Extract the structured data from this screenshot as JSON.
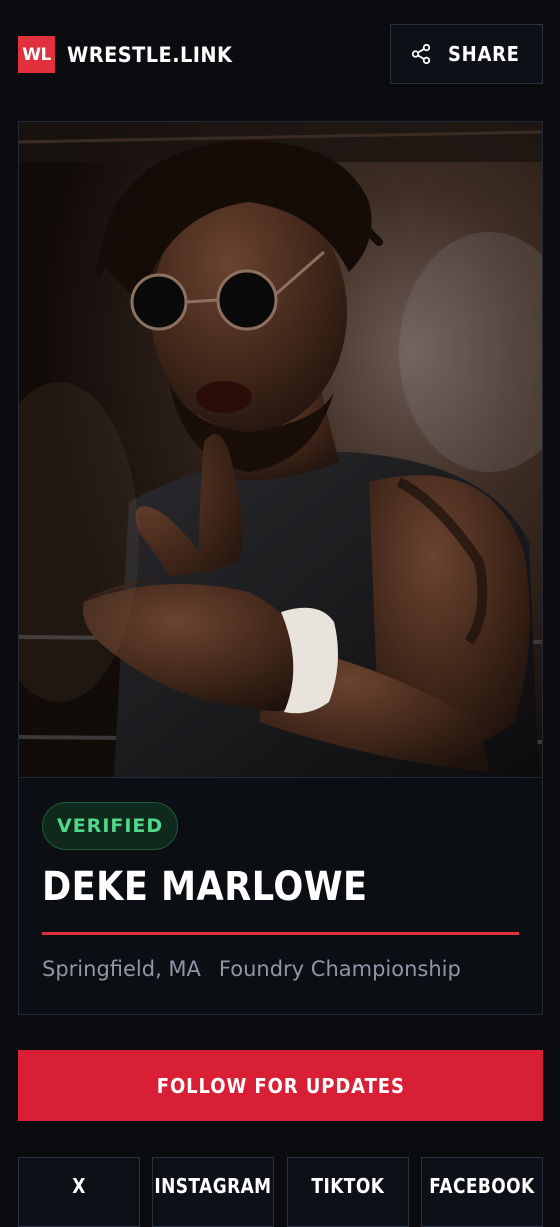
{
  "header": {
    "logo_text": "WL",
    "brand_name": "WRESTLE.LINK",
    "share_label": "SHARE"
  },
  "profile": {
    "badge": "VERIFIED",
    "name": "DEKE MARLOWE",
    "location": "Springfield, MA",
    "promotion": "Foundry Championship"
  },
  "actions": {
    "follow_label": "FOLLOW FOR UPDATES"
  },
  "socials": [
    {
      "label": "X"
    },
    {
      "label": "INSTAGRAM"
    },
    {
      "label": "TIKTOK"
    },
    {
      "label": "FACEBOOK"
    }
  ],
  "colors": {
    "background": "#0a0c10",
    "accent_red": "#d81f35",
    "logo_red": "#e0313d",
    "verified_green": "#4fd88a",
    "border": "#2a3140",
    "muted_text": "#8e97a8"
  },
  "icons": {
    "share": "share-icon"
  }
}
